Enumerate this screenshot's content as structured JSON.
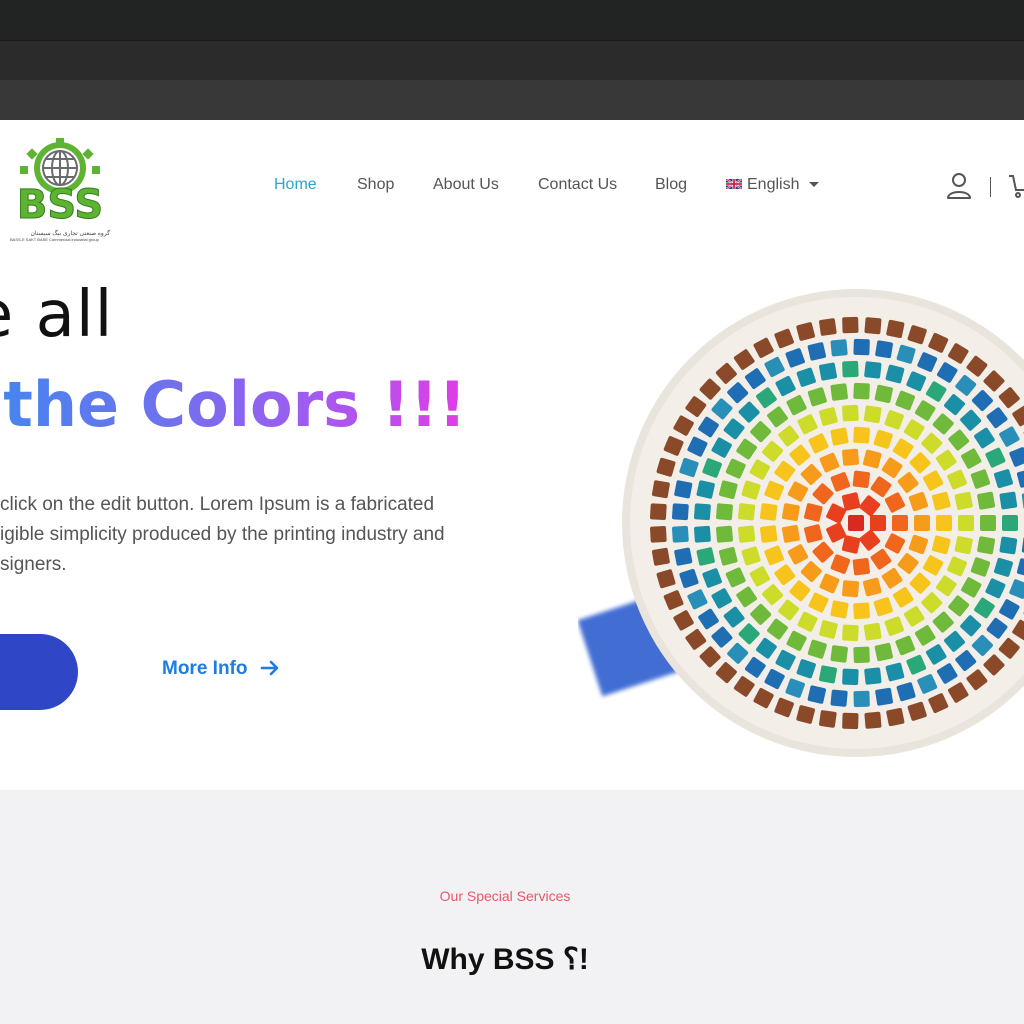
{
  "header": {
    "logo_text": "BSS",
    "logo_tagline_fa": "گروه صنعتی تجاری بیگ سیستان",
    "logo_tagline_en": "BASS-E SAKT BASE Commercial industrial group",
    "nav": [
      {
        "label": "Home",
        "active": true
      },
      {
        "label": "Shop",
        "active": false
      },
      {
        "label": "About Us",
        "active": false
      },
      {
        "label": "Contact Us",
        "active": false
      },
      {
        "label": "Blog",
        "active": false
      }
    ],
    "language": {
      "label": "English",
      "flag": "uk-flag-icon"
    },
    "icons": [
      "user-icon",
      "cart-icon"
    ],
    "accent_color": "#2aa7c9"
  },
  "hero": {
    "title_line1": "re all",
    "title_line2": "t the Colors !!!",
    "text_lines": [
      "click on the edit button. Lorem Ipsum is a fabricated",
      "igible simplicity produced by the printing industry and",
      "signers."
    ],
    "more_info_label": "More Info",
    "button_color": "#2f47c7",
    "link_color": "#1d7de2"
  },
  "services": {
    "eyebrow": "Our Special Services",
    "title": "Why BSS ؟!"
  }
}
